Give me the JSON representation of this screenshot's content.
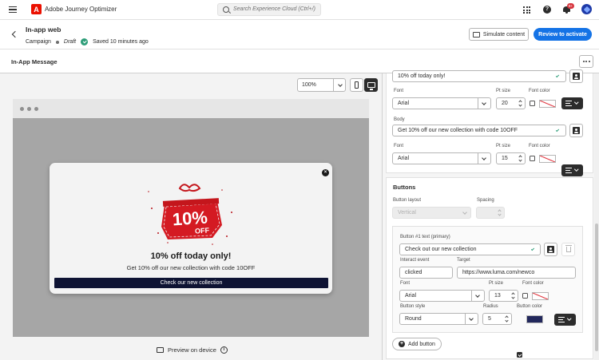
{
  "topbar": {
    "app_name": "Adobe Journey Optimizer",
    "logo_letter": "A",
    "search_placeholder": "Search Experience Cloud (Ctrl+/)",
    "help_symbol": "?",
    "notification_count": "9+"
  },
  "header": {
    "title": "In-app web",
    "type": "Campaign",
    "status": "Draft",
    "saved": "Saved 10 minutes ago",
    "simulate_label": "Simulate content",
    "review_label": "Review to activate"
  },
  "section": {
    "title": "In-App Message"
  },
  "canvas": {
    "zoom": "100%",
    "preview_label": "Preview on device",
    "info_symbol": "i"
  },
  "message": {
    "hero_text": "10%",
    "hero_sub": "OFF",
    "title": "10% off today only!",
    "body": "Get 10% off our new collection with code 10OFF",
    "button": "Check our new collection",
    "close_symbol": "×"
  },
  "panel": {
    "title_value": "10% off today only!",
    "title_font": {
      "font_label": "Font",
      "font": "Arial",
      "size_label": "Pt size",
      "size": "20",
      "color_label": "Font color"
    },
    "body_label": "Body",
    "body_value": "Get 10% off our new collection with code 10OFF",
    "body_font": {
      "font_label": "Font",
      "font": "Arial",
      "size_label": "Pt size",
      "size": "15",
      "color_label": "Font color"
    },
    "buttons": {
      "heading": "Buttons",
      "layout_label": "Button layout",
      "layout_value": "Vertical",
      "spacing_label": "Spacing",
      "button1": {
        "text_label": "Button #1 text (primary)",
        "text_value": "Check out our new collection",
        "event_label": "Interact event",
        "event_value": "clicked",
        "target_label": "Target",
        "target_value": "https://www.luma.com/newco",
        "font_label": "Font",
        "font": "Arial",
        "size_label": "Pt size",
        "size": "13",
        "color_label": "Font color",
        "style_label": "Button style",
        "style_value": "Round",
        "radius_label": "Radius",
        "radius_value": "5",
        "button_color_label": "Button color",
        "button_color": "#22285c"
      },
      "add_label": "Add button",
      "add_symbol": "+"
    }
  },
  "colors": {
    "accent": "#1473e6",
    "brand_red": "#eb1000",
    "success": "#2d9d78",
    "modal_button": "#0e1333"
  }
}
